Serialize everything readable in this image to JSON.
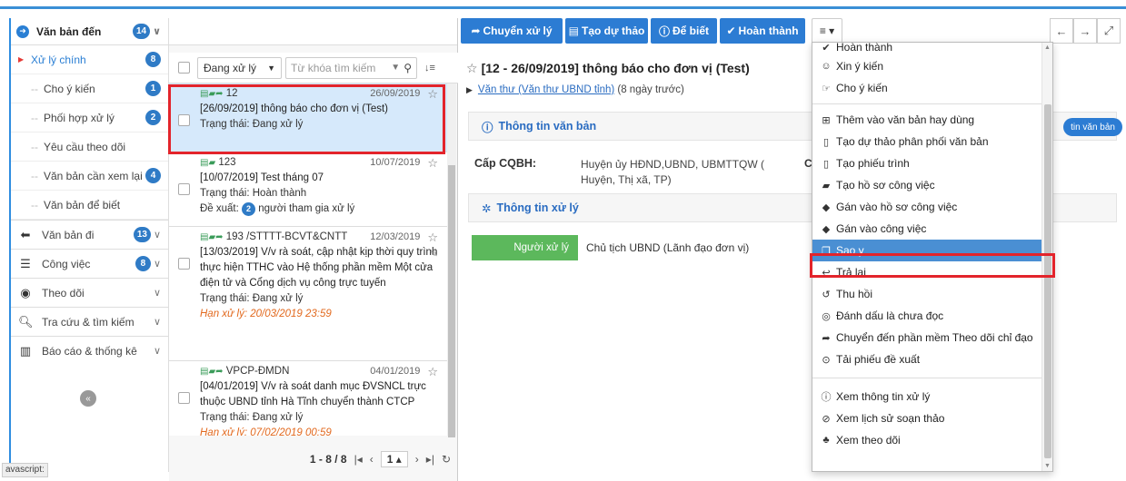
{
  "sidebar": {
    "header": {
      "label": "Văn bản đến",
      "count": "14"
    },
    "subitems": [
      {
        "label": "Xử lý chính",
        "badge": "8"
      },
      {
        "label": "Cho ý kiến",
        "badge": "1"
      },
      {
        "label": "Phối hợp xử lý",
        "badge": "2"
      },
      {
        "label": "Yêu cầu theo dõi",
        "badge": ""
      },
      {
        "label": "Văn bản cần xem lại",
        "badge": "4"
      },
      {
        "label": "Văn bản để biết",
        "badge": ""
      }
    ],
    "sections": [
      {
        "label": "Văn bản đi",
        "badge": "13"
      },
      {
        "label": "Công việc",
        "badge": "8"
      },
      {
        "label": "Theo dõi",
        "badge": ""
      },
      {
        "label": "Tra cứu & tìm kiếm",
        "badge": ""
      },
      {
        "label": "Báo cáo & thống kê",
        "badge": ""
      }
    ],
    "status_text": "avascript:"
  },
  "list": {
    "filter_value": "Đang xử lý",
    "search_placeholder": "Từ khóa tìm kiếm",
    "items": [
      {
        "code": "12",
        "date": "26/09/2019",
        "title": "[26/09/2019] thông báo cho đơn vị (Test)",
        "status": "Trạng thái: Đang xử lý"
      },
      {
        "code": "123",
        "date": "10/07/2019",
        "title": "[10/07/2019] Test tháng 07",
        "status": "Trạng thái: Hoàn thành",
        "proposal_prefix": "Đề xuất:",
        "proposal_count": "2",
        "proposal_suffix": "người tham gia xử lý"
      },
      {
        "code": "193 /STTTT-BCVT&CNTT",
        "date": "12/03/2019",
        "title": "[13/03/2019] V/v rà soát, cập nhật kịp thời quy trình thực hiện TTHC vào Hệ thống phần mềm Một cửa điện tử và Cổng dịch vụ công trực tuyến",
        "status": "Trạng thái: Đang xử lý",
        "deadline": "Hạn xử lý: 20/03/2019 23:59"
      },
      {
        "code": "VPCP-ĐMDN",
        "date": "04/01/2019",
        "title": "[04/01/2019] V/v rà soát danh mục ĐVSNCL trực thuộc UBND tỉnh Hà Tĩnh chuyển thành CTCP",
        "status": "Trạng thái: Đang xử lý",
        "deadline": "Hạn xử lý: 07/02/2019 00:59"
      }
    ],
    "pager": {
      "range": "1 - 8 / 8",
      "page": "1"
    }
  },
  "toolbar": {
    "forward": "Chuyển xử lý",
    "draft": "Tạo dự thảo",
    "info": "Để biết",
    "complete": "Hoàn thành"
  },
  "detail": {
    "title": "[12 - 26/09/2019] thông báo cho đơn vị (Test)",
    "sender_link": "Văn thư (Văn thư UBND tỉnh)",
    "sender_time": "(8 ngày trước)",
    "section_info": "Thông tin văn bản",
    "pill": "tin văn bản",
    "level_label": "Cấp CQBH:",
    "level_value": "Huyện ủy HĐND,UBND, UBMTTQW ( Huyện, Thị xã, TP)",
    "level_extra": "C",
    "section_process": "Thông tin xử lý",
    "handler_label": "Người xử lý",
    "handler_value": "Chủ tịch UBND (Lãnh đạo đơn vị)"
  },
  "menu": {
    "items": [
      {
        "label": "Hoàn thành",
        "icon": "check-icon"
      },
      {
        "label": "Xin ý kiến",
        "icon": "smile-icon"
      },
      {
        "label": "Cho ý kiến",
        "icon": "hand-point-icon"
      },
      {
        "label": "Thêm vào văn bản hay dùng",
        "icon": "plus-square-icon"
      },
      {
        "label": "Tạo dự thảo phân phối văn bản",
        "icon": "file-icon"
      },
      {
        "label": "Tạo phiếu trình",
        "icon": "file-icon"
      },
      {
        "label": "Tạo hồ sơ công việc",
        "icon": "book-icon"
      },
      {
        "label": "Gán vào hồ sơ công việc",
        "icon": "tag-icon"
      },
      {
        "label": "Gán vào công việc",
        "icon": "tag-icon"
      },
      {
        "label": "Sao y",
        "icon": "copy-icon"
      },
      {
        "label": "Trả lại",
        "icon": "reply-icon"
      },
      {
        "label": "Thu hồi",
        "icon": "undo-icon"
      },
      {
        "label": "Đánh dấu là chưa đọc",
        "icon": "eye-slash-icon"
      },
      {
        "label": "Chuyển đến phần mềm Theo dõi chỉ đạo",
        "icon": "share-icon"
      },
      {
        "label": "Tải phiếu đề xuất",
        "icon": "download-circle-icon"
      },
      {
        "label": "Xem thông tin xử lý",
        "icon": "info-circle-icon"
      },
      {
        "label": "Xem lịch sử soạn thảo",
        "icon": "history-icon"
      },
      {
        "label": "Xem theo dõi",
        "icon": "sitemap-icon"
      }
    ]
  },
  "colors": {
    "primary": "#2c7cd3",
    "highlight": "#4a8fd3",
    "annotation": "#e3242b",
    "success": "#5cb85c",
    "deadline": "#e2691e"
  }
}
